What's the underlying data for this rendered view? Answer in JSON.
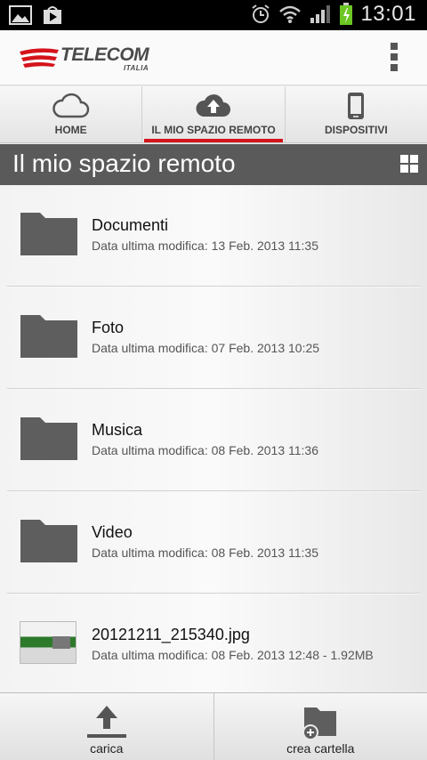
{
  "status_bar": {
    "time": "13:01",
    "icons": [
      "gallery-icon",
      "play-store-icon",
      "alarm-icon",
      "wifi-icon",
      "signal-icon",
      "battery-charging-icon"
    ]
  },
  "header": {
    "logo_main": "TELECOM",
    "logo_sub": "ITALIA",
    "menu_icon": "overflow-menu-icon"
  },
  "tabs": [
    {
      "label": "HOME",
      "icon": "cloud-icon",
      "active": false
    },
    {
      "label": "IL MIO SPAZIO REMOTO",
      "icon": "cloud-upload-icon",
      "active": true
    },
    {
      "label": "DISPOSITIVI",
      "icon": "phone-icon",
      "active": false
    }
  ],
  "page": {
    "title": "Il mio spazio remoto",
    "view_toggle_icon": "grid-view-icon"
  },
  "files": [
    {
      "name": "Documenti",
      "meta": "Data ultima modifica: 13 Feb. 2013 11:35",
      "type": "folder"
    },
    {
      "name": "Foto",
      "meta": "Data ultima modifica: 07 Feb. 2013 10:25",
      "type": "folder"
    },
    {
      "name": "Musica",
      "meta": "Data ultima modifica: 08 Feb. 2013 11:36",
      "type": "folder"
    },
    {
      "name": "Video",
      "meta": "Data ultima modifica: 08 Feb. 2013 11:35",
      "type": "folder"
    },
    {
      "name": "20121211_215340.jpg",
      "meta": "Data ultima modifica: 08 Feb. 2013 12:48 - 1.92MB",
      "type": "image"
    }
  ],
  "bottom": {
    "upload_label": "carica",
    "new_folder_label": "crea cartella"
  },
  "colors": {
    "accent": "#d4131b",
    "titlebar": "#5a5a5a",
    "folder": "#5e5e5e"
  }
}
